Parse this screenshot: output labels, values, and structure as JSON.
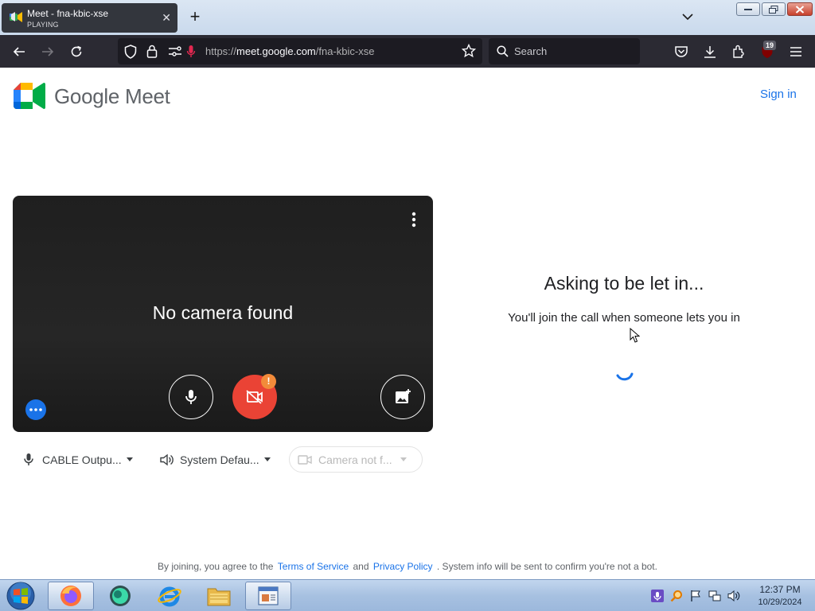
{
  "browser": {
    "tab": {
      "title": "Meet - fna-kbic-xse",
      "status": "PLAYING"
    },
    "url": {
      "scheme": "https://",
      "host": "meet.google.com",
      "path": "/fna-kbic-xse"
    },
    "search_placeholder": "Search",
    "extension_badge": "19"
  },
  "meet": {
    "brand": "Google Meet",
    "sign_in": "Sign in",
    "preview": {
      "message": "No camera found",
      "camera_alert": "!"
    },
    "devices": {
      "microphone": "CABLE Outpu...",
      "speaker": "System Defau...",
      "camera": "Camera not f..."
    },
    "status": {
      "title": "Asking to be let in...",
      "body": "You'll join the call when someone lets you in"
    },
    "footer": {
      "prefix": "By joining, you agree to the",
      "terms": "Terms of Service",
      "and": "and",
      "privacy": "Privacy Policy",
      "suffix": ". System info will be sent to confirm you're not a bot."
    },
    "colors": {
      "accent": "#1a73e8",
      "camera_off": "#ea4335"
    }
  },
  "taskbar": {
    "clock": {
      "time": "12:37 PM",
      "date": "10/29/2024"
    },
    "pinned": [
      "firefox-icon",
      "teams-icon",
      "internet-explorer-icon",
      "file-explorer-icon",
      "window-app-icon"
    ]
  }
}
